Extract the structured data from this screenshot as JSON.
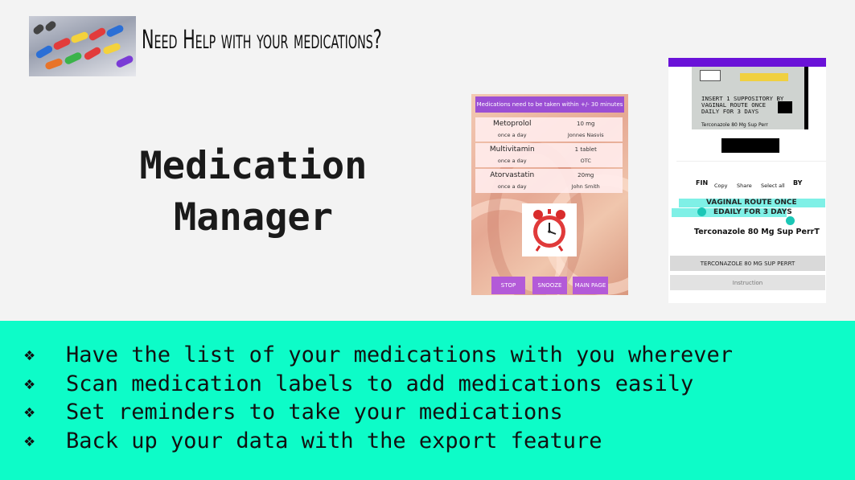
{
  "header": {
    "title": "Need Help with your medications?"
  },
  "main": {
    "title_line1": "Medication",
    "title_line2": "Manager"
  },
  "reminder_screen": {
    "banner": "Medications need to be taken within +/- 30 minutes",
    "medications": [
      {
        "name": "Metoprolol",
        "dose": "10 mg",
        "frequency": "once a day",
        "prescriber": "Jonnes Nasvis"
      },
      {
        "name": "Multivitamin",
        "dose": "1 tablet",
        "frequency": "once a day",
        "prescriber": "OTC"
      },
      {
        "name": "Atorvastatin",
        "dose": "20mg",
        "frequency": "once a day",
        "prescriber": "John Smith"
      }
    ],
    "buttons": {
      "stop": "STOP",
      "snooze": "SNOOZE",
      "main_page": "MAIN PAGE"
    }
  },
  "scan_screen": {
    "label_text": {
      "line1": "INSERT 1 SUPPOSITORY BY",
      "line2": "VAGINAL ROUTE ONCE",
      "line3": "DAILY FOR 3 DAYS",
      "drug": "Terconazole 80 Mg Sup Perr"
    },
    "selection_row": {
      "left_fragment": "FIN",
      "copy": "Copy",
      "share": "Share",
      "select_all": "Select all",
      "right_fragment": "BY"
    },
    "highlight_line1": "VAGINAL ROUTE ONCE",
    "highlight_line2": "EDAILY FOR 3 DAYS",
    "drug_name": "Terconazole 80 Mg Sup PerrT",
    "buttons": {
      "drug": "TERCONAZOLE 80 MG SUP PERRT",
      "instruction": "Instruction"
    }
  },
  "bullets": {
    "symbol": "❖",
    "items": [
      "Have the list of your medications with you wherever",
      "Scan medication labels to add medications easily",
      "Set reminders to take your medications",
      "Back up your data with the export feature"
    ]
  },
  "colors": {
    "band": "#0dfcc8",
    "purple": "#9b4fd4",
    "scan_bar": "#6a12d8",
    "highlight": "#7ff0e6"
  }
}
